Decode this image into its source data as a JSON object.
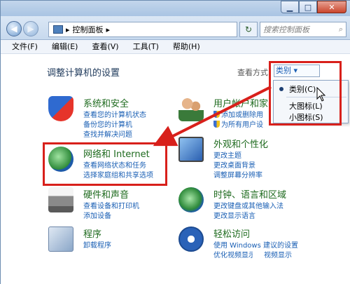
{
  "window": {
    "min_label": "▁",
    "max_label": "□",
    "close_label": "✕"
  },
  "address": {
    "path": "控制面板",
    "search_placeholder": "搜索控制面板"
  },
  "menu": [
    "文件(F)",
    "编辑(E)",
    "查看(V)",
    "工具(T)",
    "帮助(H)"
  ],
  "page": {
    "heading": "调整计算机的设置",
    "view_by_label": "查看方式",
    "view_value": "类别 ▾"
  },
  "dropdown": {
    "items": [
      "类别(C)",
      "大图标(L)",
      "小图标(S)"
    ]
  },
  "categories": {
    "system": {
      "title": "系统和安全",
      "links": [
        "查看您的计算机状态",
        "备份您的计算机",
        "查找并解决问题"
      ]
    },
    "user": {
      "title": "用户帐户和家",
      "links": [
        "添加或删除用",
        "为所有用户设"
      ]
    },
    "network": {
      "title": "网络和 Internet",
      "links": [
        "查看网络状态和任务",
        "选择家庭组和共享选项"
      ]
    },
    "appearance": {
      "title": "外观和个性化",
      "links": [
        "更改主题",
        "更改桌面背景",
        "调整屏幕分辨率"
      ]
    },
    "hardware": {
      "title": "硬件和声音",
      "links": [
        "查看设备和打印机",
        "添加设备"
      ]
    },
    "clock": {
      "title": "时钟、语言和区域",
      "links": [
        "更改键盘或其他输入法",
        "更改显示语言"
      ]
    },
    "programs": {
      "title": "程序",
      "links": [
        "卸载程序"
      ]
    },
    "access": {
      "title": "轻松访问",
      "links": [
        "使用 Windows 建议的设置",
        "优化视频显示",
        "视频显示"
      ]
    }
  },
  "colors": {
    "annotation_red": "#d8201b",
    "link_blue": "#1a5fb4",
    "title_green": "#1e6a1e"
  }
}
